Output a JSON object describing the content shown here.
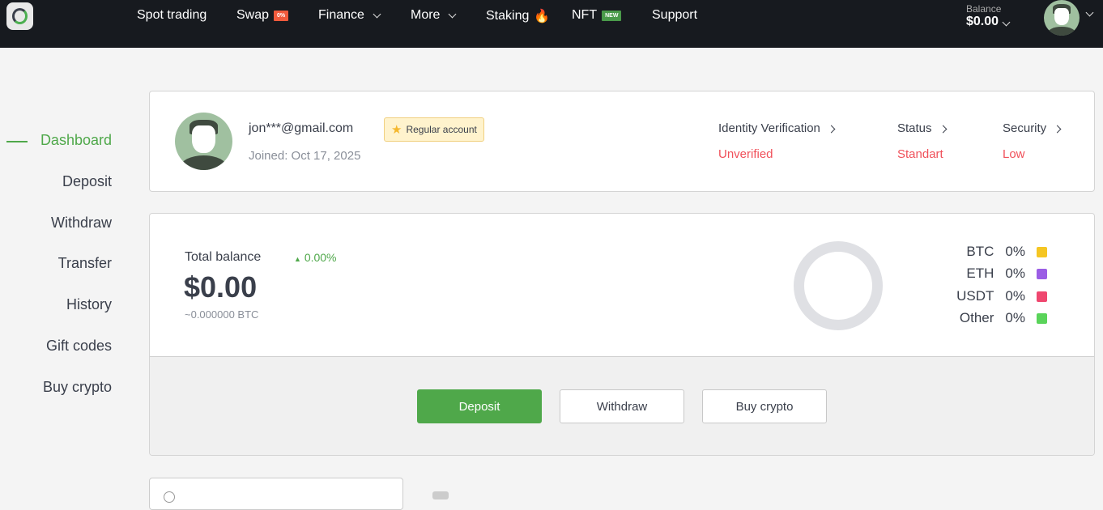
{
  "header": {
    "nav": [
      {
        "label": "Spot trading"
      },
      {
        "label": "Swap",
        "badge": "0%"
      },
      {
        "label": "Finance"
      },
      {
        "label": "More"
      },
      {
        "label": "Staking"
      },
      {
        "label": "NFT",
        "badge": "NEW"
      },
      {
        "label": "Support"
      }
    ],
    "balance_label": "Balance",
    "balance_value": "$0.00"
  },
  "sidebar": {
    "items": [
      "Dashboard",
      "Deposit",
      "Withdraw",
      "Transfer",
      "History",
      "Gift codes",
      "Buy crypto"
    ]
  },
  "profile": {
    "email": "jon***@gmail.com",
    "account_badge": "Regular account",
    "joined": "Joined: Oct 17, 2025",
    "stats": [
      {
        "label": "Identity Verification",
        "value": "Unverified"
      },
      {
        "label": "Status",
        "value": "Standart"
      },
      {
        "label": "Security",
        "value": "Low"
      }
    ]
  },
  "balance": {
    "label": "Total balance",
    "change": "0.00%",
    "value": "$0.00",
    "btc": "~0.000000 BTC",
    "legend": [
      {
        "name": "BTC",
        "pct": "0%",
        "color": "#f5c623"
      },
      {
        "name": "ETH",
        "pct": "0%",
        "color": "#9b5de5"
      },
      {
        "name": "USDT",
        "pct": "0%",
        "color": "#ef476f"
      },
      {
        "name": "Other",
        "pct": "0%",
        "color": "#5ad45a"
      }
    ]
  },
  "actions": {
    "deposit": "Deposit",
    "withdraw": "Withdraw",
    "buy": "Buy crypto"
  },
  "colors": {
    "accent": "#4fa84a",
    "negative": "#f0505a"
  }
}
